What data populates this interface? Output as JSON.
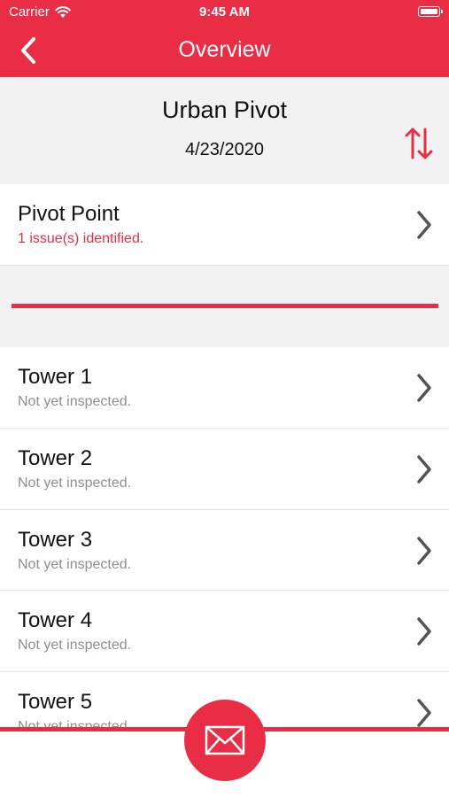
{
  "status_bar": {
    "carrier": "Carrier",
    "time": "9:45 AM"
  },
  "nav": {
    "title": "Overview",
    "back_icon": "chevron-left-icon"
  },
  "header": {
    "title": "Urban Pivot",
    "date": "4/23/2020",
    "sort_icon": "sort-arrows-icon"
  },
  "pivot_point": {
    "title": "Pivot Point",
    "status": "1 issue(s) identified."
  },
  "towers": [
    {
      "title": "Tower 1",
      "status": "Not yet inspected."
    },
    {
      "title": "Tower 2",
      "status": "Not yet inspected."
    },
    {
      "title": "Tower 3",
      "status": "Not yet inspected."
    },
    {
      "title": "Tower 4",
      "status": "Not yet inspected."
    },
    {
      "title": "Tower 5",
      "status": "Not yet inspected."
    }
  ],
  "actions": {
    "mail_icon": "mail-icon"
  },
  "colors": {
    "accent": "#e82d45",
    "header_bg": "#f2f2f2",
    "subtitle": "#8e8e8e",
    "chevron": "#555555"
  }
}
